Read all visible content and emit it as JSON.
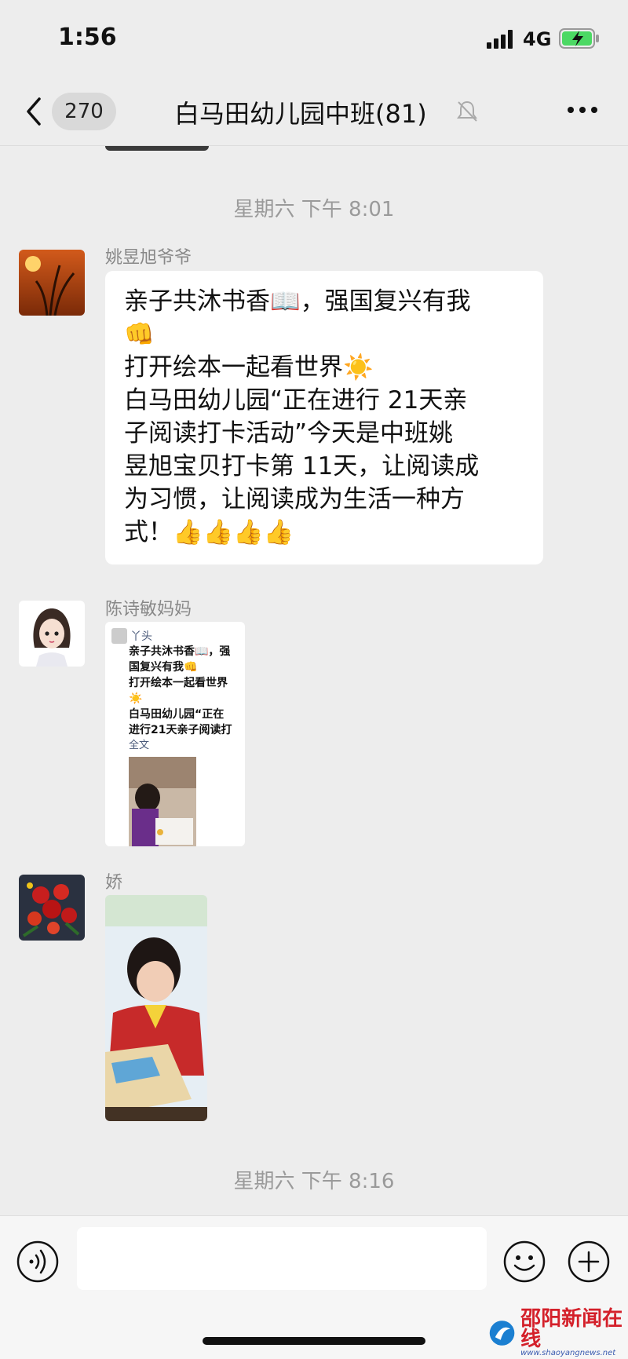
{
  "status": {
    "time": "1:56",
    "network": "4G"
  },
  "nav": {
    "unread_count": "270",
    "title": "白马田幼儿园中班(81)"
  },
  "timestamps": [
    "星期六 下午 8:01",
    "星期六 下午 8:16"
  ],
  "messages": [
    {
      "sender": "姚昱旭爷爷",
      "lines": [
        "亲子共沐书香📖，强国复兴有我",
        "👊",
        "打开绘本一起看世界☀️",
        "白马田幼儿园“正在进行 21天亲",
        "子阅读打卡活动”今天是中班姚",
        "昱旭宝贝打卡第 11天，让阅读成",
        "为习惯，让阅读成为生活一种方",
        "式！👍👍👍👍"
      ]
    },
    {
      "sender": "陈诗敏妈妈",
      "card": {
        "author": "丫头",
        "lines": [
          "亲子共沐书香📖，强",
          "国复兴有我👊",
          "打开绘本一起看世界",
          "☀️",
          "白马田幼儿园“正在",
          "进行21天亲子阅读打"
        ],
        "more": "全文"
      }
    },
    {
      "sender": "娇"
    }
  ],
  "watermark": {
    "name": "邵阳新闻在线",
    "url": "www.shaoyangnews.net"
  },
  "colors": {
    "background": "#ededed",
    "bubble": "#ffffff",
    "watermark_red": "#d4202a"
  }
}
